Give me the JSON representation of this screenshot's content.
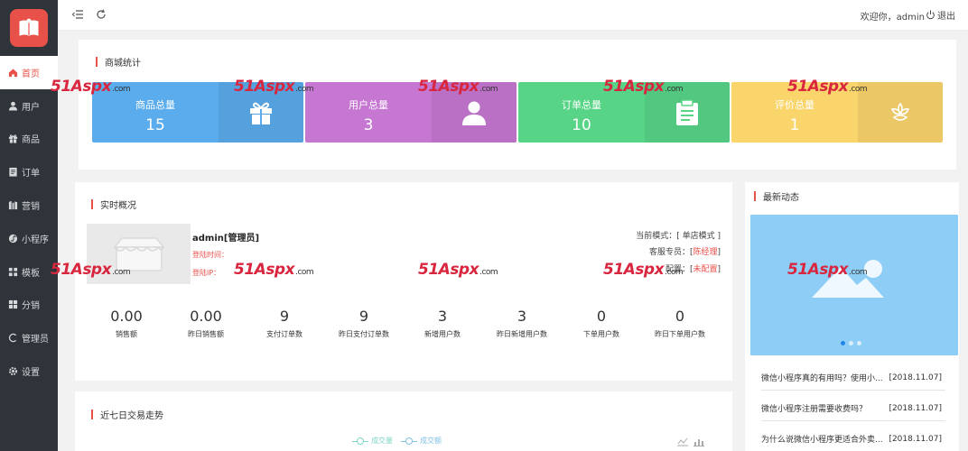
{
  "sidebar": {
    "items": [
      {
        "label": "首页",
        "icon": "home-icon",
        "active": true
      },
      {
        "label": "用户",
        "icon": "user-icon"
      },
      {
        "label": "商品",
        "icon": "gift-icon"
      },
      {
        "label": "订单",
        "icon": "order-icon"
      },
      {
        "label": "营销",
        "icon": "marketing-icon"
      },
      {
        "label": "小程序",
        "icon": "miniprogram-icon"
      },
      {
        "label": "模板",
        "icon": "template-icon"
      },
      {
        "label": "分销",
        "icon": "distribution-icon"
      },
      {
        "label": "管理员",
        "icon": "admin-icon"
      },
      {
        "label": "设置",
        "icon": "settings-icon"
      }
    ]
  },
  "header": {
    "welcome": "欢迎你，admin",
    "logout": "退出"
  },
  "stats": {
    "title": "商城统计",
    "cards": [
      {
        "label": "商品总量",
        "value": "15",
        "color": "#5aacec",
        "icon": "gift-icon"
      },
      {
        "label": "用户总量",
        "value": "3",
        "color": "#c577d2",
        "icon": "user-icon"
      },
      {
        "label": "订单总量",
        "value": "10",
        "color": "#58d487",
        "icon": "clipboard-icon"
      },
      {
        "label": "评价总量",
        "value": "1",
        "color": "#fad56c",
        "icon": "flower-icon"
      }
    ]
  },
  "realtime": {
    "title": "实时概况",
    "admin_name": "admin[管理员]",
    "login_time": "登陆时间：",
    "login_ip": "登陆IP：",
    "mode_label": "当前模式：[ 单店模式 ]",
    "service_label": "客服专员：[",
    "service_value": "陈经理",
    "config_label": "配置：[",
    "config_value": "未配置",
    "close_bracket": "]",
    "metrics": [
      {
        "value": "0.00",
        "label": "销售额"
      },
      {
        "value": "0.00",
        "label": "昨日销售额"
      },
      {
        "value": "9",
        "label": "支付订单数"
      },
      {
        "value": "9",
        "label": "昨日支付订单数"
      },
      {
        "value": "3",
        "label": "新增用户数"
      },
      {
        "value": "3",
        "label": "昨日新增用户数"
      },
      {
        "value": "0",
        "label": "下单用户数"
      },
      {
        "value": "0",
        "label": "昨日下单用户数"
      }
    ]
  },
  "news": {
    "title": "最新动态",
    "items": [
      {
        "title": "微信小程序真的有用吗？使用小...",
        "date": "[2018.11.07]"
      },
      {
        "title": "微信小程序注册需要收费吗？",
        "date": "[2018.11.07]"
      },
      {
        "title": "为什么说微信小程序更适合外卖...",
        "date": "[2018.11.07]"
      }
    ]
  },
  "trend": {
    "title": "近七日交易走势",
    "legend": [
      "成交量",
      "成交额"
    ]
  },
  "watermark": {
    "brand": "51Aspx",
    "suffix": ".com"
  }
}
